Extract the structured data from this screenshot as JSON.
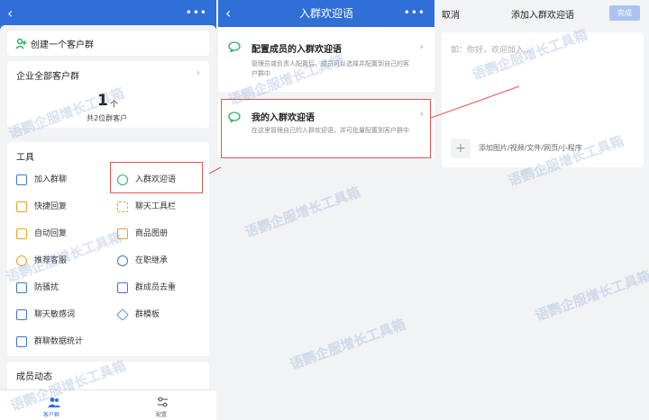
{
  "screen1": {
    "create_group": "创建一个客户群",
    "all_groups_title": "企业全部客户群",
    "group_count": "1",
    "group_count_unit": "个",
    "group_customers": "共2位群客户",
    "tools_title": "工具",
    "tools": [
      {
        "label": "加入群聊",
        "icon": "join-group-icon"
      },
      {
        "label": "入群欢迎语",
        "icon": "welcome-message-icon"
      },
      {
        "label": "快捷回复",
        "icon": "quick-reply-icon"
      },
      {
        "label": "聊天工具栏",
        "icon": "chat-toolbar-icon"
      },
      {
        "label": "自动回复",
        "icon": "auto-reply-icon"
      },
      {
        "label": "商品图册",
        "icon": "product-album-icon"
      },
      {
        "label": "推荐客服",
        "icon": "recommend-service-icon"
      },
      {
        "label": "在职继承",
        "icon": "on-job-transfer-icon"
      },
      {
        "label": "防骚扰",
        "icon": "anti-harassment-icon"
      },
      {
        "label": "群成员去重",
        "icon": "member-dedup-icon"
      },
      {
        "label": "聊天敏感词",
        "icon": "sensitive-words-icon"
      },
      {
        "label": "群模板",
        "icon": "group-template-icon"
      },
      {
        "label": "群聊数据统计",
        "icon": "group-stats-icon"
      }
    ],
    "member_dynamics_title": "成员动态",
    "tabbar": [
      {
        "label": "客户群",
        "icon": "customer-group-icon"
      },
      {
        "label": "配置",
        "icon": "settings-sliders-icon"
      }
    ]
  },
  "screen2": {
    "title": "入群欢迎语",
    "items": [
      {
        "title": "配置成员的入群欢迎语",
        "desc": "管理员或负责人配置后，成员可以选择并配置到自己的客户群中"
      },
      {
        "title": "我的入群欢迎语",
        "desc": "在这里管理自己的入群欢迎语，并可批量配置到客户群中"
      }
    ]
  },
  "screen3": {
    "cancel": "取消",
    "title": "添加入群欢迎语",
    "done": "完成",
    "placeholder": "如：你好，欢迎加入...",
    "attach_hint": "添加图片/视频/文件/网页/小程序"
  },
  "watermark": "语鹦企服增长工具箱",
  "colors": {
    "primary": "#2f6fd6",
    "accent_green": "#2aae67",
    "highlight": "#e05555"
  }
}
